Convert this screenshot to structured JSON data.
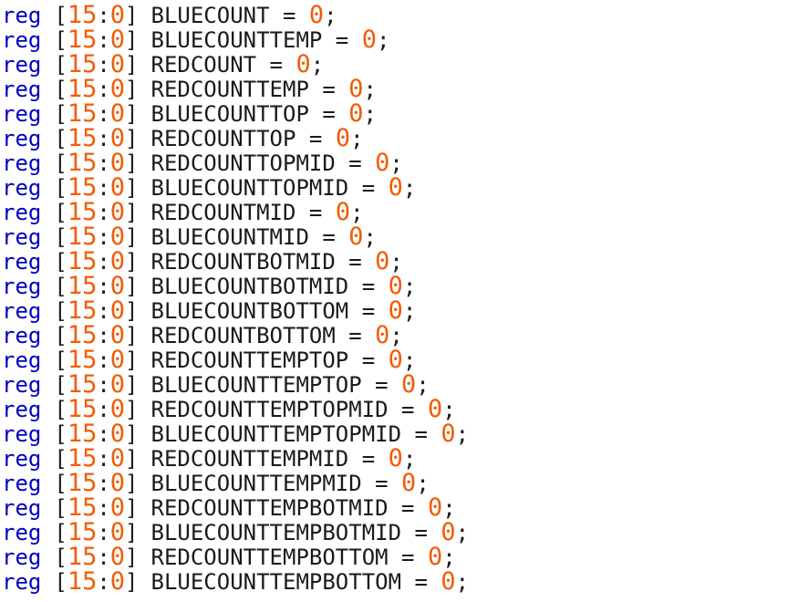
{
  "editor": {
    "lines": [
      {
        "keyword": "reg",
        "width_hi": "15",
        "width_lo": "0",
        "name": "BLUECOUNT",
        "value": "0"
      },
      {
        "keyword": "reg",
        "width_hi": "15",
        "width_lo": "0",
        "name": "BLUECOUNTTEMP",
        "value": "0"
      },
      {
        "keyword": "reg",
        "width_hi": "15",
        "width_lo": "0",
        "name": "REDCOUNT",
        "value": "0"
      },
      {
        "keyword": "reg",
        "width_hi": "15",
        "width_lo": "0",
        "name": "REDCOUNTTEMP",
        "value": "0"
      },
      {
        "keyword": "reg",
        "width_hi": "15",
        "width_lo": "0",
        "name": "BLUECOUNTTOP",
        "value": "0"
      },
      {
        "keyword": "reg",
        "width_hi": "15",
        "width_lo": "0",
        "name": "REDCOUNTTOP",
        "value": "0"
      },
      {
        "keyword": "reg",
        "width_hi": "15",
        "width_lo": "0",
        "name": "REDCOUNTTOPMID",
        "value": "0"
      },
      {
        "keyword": "reg",
        "width_hi": "15",
        "width_lo": "0",
        "name": "BLUECOUNTTOPMID",
        "value": "0"
      },
      {
        "keyword": "reg",
        "width_hi": "15",
        "width_lo": "0",
        "name": "REDCOUNTMID",
        "value": "0"
      },
      {
        "keyword": "reg",
        "width_hi": "15",
        "width_lo": "0",
        "name": "BLUECOUNTMID",
        "value": "0"
      },
      {
        "keyword": "reg",
        "width_hi": "15",
        "width_lo": "0",
        "name": "REDCOUNTBOTMID",
        "value": "0"
      },
      {
        "keyword": "reg",
        "width_hi": "15",
        "width_lo": "0",
        "name": "BLUECOUNTBOTMID",
        "value": "0"
      },
      {
        "keyword": "reg",
        "width_hi": "15",
        "width_lo": "0",
        "name": "BLUECOUNTBOTTOM",
        "value": "0"
      },
      {
        "keyword": "reg",
        "width_hi": "15",
        "width_lo": "0",
        "name": "REDCOUNTBOTTOM",
        "value": "0"
      },
      {
        "keyword": "reg",
        "width_hi": "15",
        "width_lo": "0",
        "name": "REDCOUNTTEMPTOP",
        "value": "0"
      },
      {
        "keyword": "reg",
        "width_hi": "15",
        "width_lo": "0",
        "name": "BLUECOUNTTEMPTOP",
        "value": "0"
      },
      {
        "keyword": "reg",
        "width_hi": "15",
        "width_lo": "0",
        "name": "REDCOUNTTEMPTOPMID",
        "value": "0"
      },
      {
        "keyword": "reg",
        "width_hi": "15",
        "width_lo": "0",
        "name": "BLUECOUNTTEMPTOPMID",
        "value": "0"
      },
      {
        "keyword": "reg",
        "width_hi": "15",
        "width_lo": "0",
        "name": "REDCOUNTTEMPMID",
        "value": "0"
      },
      {
        "keyword": "reg",
        "width_hi": "15",
        "width_lo": "0",
        "name": "BLUECOUNTTEMPMID",
        "value": "0"
      },
      {
        "keyword": "reg",
        "width_hi": "15",
        "width_lo": "0",
        "name": "REDCOUNTTEMPBOTMID",
        "value": "0"
      },
      {
        "keyword": "reg",
        "width_hi": "15",
        "width_lo": "0",
        "name": "BLUECOUNTTEMPBOTMID",
        "value": "0"
      },
      {
        "keyword": "reg",
        "width_hi": "15",
        "width_lo": "0",
        "name": "REDCOUNTTEMPBOTTOM",
        "value": "0"
      },
      {
        "keyword": "reg",
        "width_hi": "15",
        "width_lo": "0",
        "name": "BLUECOUNTTEMPBOTTOM",
        "value": "0"
      }
    ]
  },
  "colors": {
    "keyword": "#0000c0",
    "number": "#f25c05",
    "text": "#1a1a1a",
    "background": "#ffffff"
  }
}
